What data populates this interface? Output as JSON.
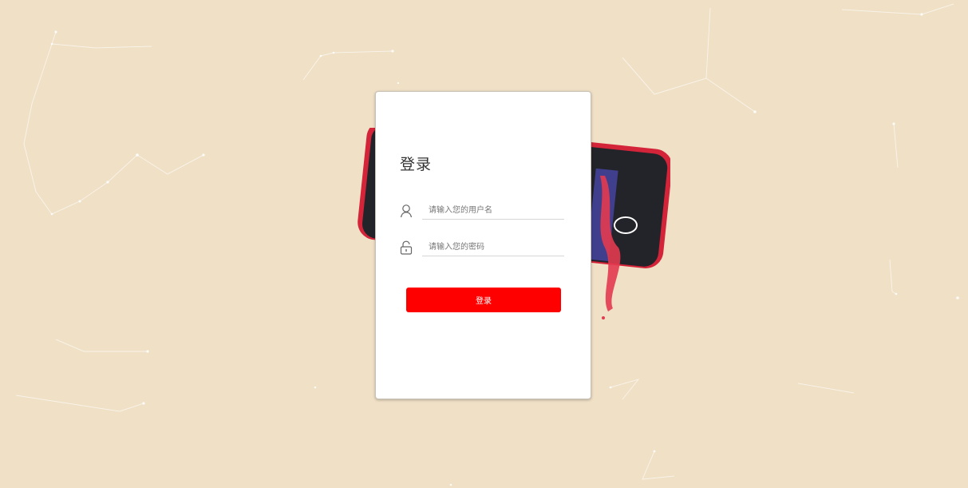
{
  "login": {
    "title": "登录",
    "username_placeholder": "请输入您的用户名",
    "password_placeholder": "请输入您的密码",
    "submit_label": "登录"
  },
  "icons": {
    "username": "user-icon",
    "password": "lock-icon"
  },
  "colors": {
    "background": "#efe0c6",
    "accent": "#ff0000",
    "card": "#ffffff"
  }
}
